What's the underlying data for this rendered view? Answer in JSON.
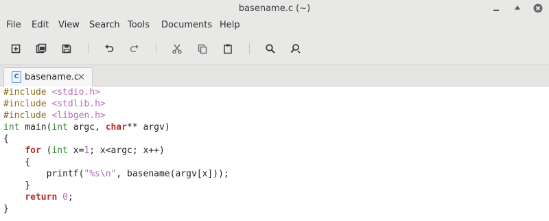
{
  "window": {
    "title": "basename.c (~)"
  },
  "menu": [
    "File",
    "Edit",
    "View",
    "Search",
    "Tools",
    "Documents",
    "Help"
  ],
  "toolbar": {
    "buttons": [
      "new-document",
      "open-document",
      "save",
      "undo",
      "redo",
      "cut",
      "copy",
      "paste",
      "find",
      "find-replace"
    ]
  },
  "tab": {
    "label": "basename.c",
    "close": "×",
    "file_icon_letter": "C"
  },
  "code": [
    [
      {
        "t": "#include ",
        "c": "pre"
      },
      {
        "t": "<stdio.h>",
        "c": "str"
      }
    ],
    [
      {
        "t": "#include ",
        "c": "pre"
      },
      {
        "t": "<stdlib.h>",
        "c": "str"
      }
    ],
    [
      {
        "t": "#include ",
        "c": "pre"
      },
      {
        "t": "<libgen.h>",
        "c": "str"
      }
    ],
    [
      {
        "t": "int",
        "c": "typ"
      },
      {
        "t": " main(",
        "c": ""
      },
      {
        "t": "int",
        "c": "typ"
      },
      {
        "t": " argc, ",
        "c": ""
      },
      {
        "t": "char",
        "c": "kw"
      },
      {
        "t": "** argv)",
        "c": ""
      }
    ],
    [
      {
        "t": "{",
        "c": ""
      }
    ],
    [
      {
        "t": "    ",
        "c": ""
      },
      {
        "t": "for",
        "c": "kw"
      },
      {
        "t": " (",
        "c": ""
      },
      {
        "t": "int",
        "c": "typ"
      },
      {
        "t": " x=",
        "c": ""
      },
      {
        "t": "1",
        "c": "num"
      },
      {
        "t": "; x<argc; x++)",
        "c": ""
      }
    ],
    [
      {
        "t": "    {",
        "c": ""
      }
    ],
    [
      {
        "t": "        printf(",
        "c": ""
      },
      {
        "t": "\"%s\\n\"",
        "c": "str"
      },
      {
        "t": ", basename(argv[x]));",
        "c": ""
      }
    ],
    [
      {
        "t": "    }",
        "c": ""
      }
    ],
    [
      {
        "t": "    ",
        "c": ""
      },
      {
        "t": "return",
        "c": "kw"
      },
      {
        "t": " ",
        "c": ""
      },
      {
        "t": "0",
        "c": "num"
      },
      {
        "t": ";",
        "c": ""
      }
    ],
    [
      {
        "t": "}",
        "c": ""
      }
    ]
  ]
}
